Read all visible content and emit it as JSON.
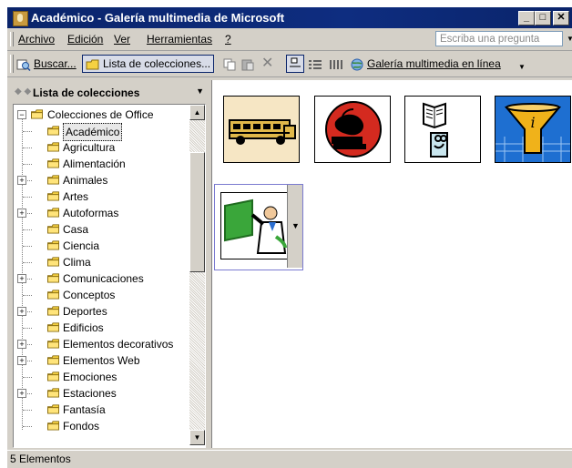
{
  "window": {
    "title": "Académico - Galería multimedia de Microsoft",
    "minimize": "_",
    "maximize": "□",
    "close": "✕"
  },
  "menubar": {
    "items": [
      "Archivo",
      "Edición",
      "Ver",
      "Herramientas",
      "?"
    ],
    "ask_placeholder": "Escriba una pregunta"
  },
  "toolbar": {
    "search_label": "Buscar...",
    "collections_label": "Lista de colecciones...",
    "online_label": "Galería multimedia en línea"
  },
  "left_pane": {
    "header": "Lista de colecciones",
    "root": "Colecciones de Office",
    "items": [
      {
        "label": "Académico",
        "expandable": false,
        "selected": true
      },
      {
        "label": "Agricultura",
        "expandable": false
      },
      {
        "label": "Alimentación",
        "expandable": false
      },
      {
        "label": "Animales",
        "expandable": true
      },
      {
        "label": "Artes",
        "expandable": false
      },
      {
        "label": "Autoformas",
        "expandable": true
      },
      {
        "label": "Casa",
        "expandable": false
      },
      {
        "label": "Ciencia",
        "expandable": false
      },
      {
        "label": "Clima",
        "expandable": false
      },
      {
        "label": "Comunicaciones",
        "expandable": true
      },
      {
        "label": "Conceptos",
        "expandable": false
      },
      {
        "label": "Deportes",
        "expandable": true
      },
      {
        "label": "Edificios",
        "expandable": false
      },
      {
        "label": "Elementos decorativos",
        "expandable": true
      },
      {
        "label": "Elementos Web",
        "expandable": true
      },
      {
        "label": "Emociones",
        "expandable": false
      },
      {
        "label": "Estaciones",
        "expandable": true
      },
      {
        "label": "Fantasía",
        "expandable": false
      },
      {
        "label": "Fondos",
        "expandable": false
      }
    ]
  },
  "clips": [
    {
      "icon": "school-bus-icon"
    },
    {
      "icon": "apple-books-icon"
    },
    {
      "icon": "book-reading-icon"
    },
    {
      "icon": "funnel-info-icon"
    },
    {
      "icon": "teacher-board-icon"
    }
  ],
  "status": {
    "text": "5 Elementos"
  },
  "colors": {
    "title_bar": "#0a246a",
    "face": "#d4d0c8",
    "folder": "#f5d142"
  }
}
